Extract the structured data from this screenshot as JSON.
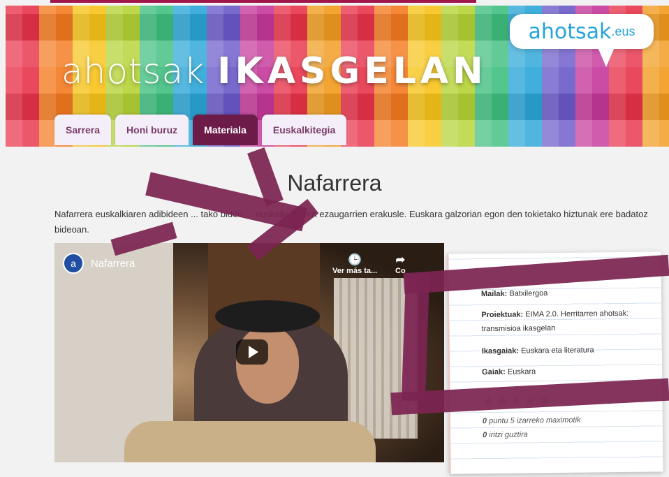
{
  "header": {
    "logo_part1": "ahotsak",
    "logo_part2": "IKASGELAN",
    "bubble_brand": "ahotsak",
    "bubble_tld": ".eus"
  },
  "tabs": [
    {
      "label": "Sarrera",
      "active": false
    },
    {
      "label": "Honi buruz",
      "active": false
    },
    {
      "label": "Materiala",
      "active": true
    },
    {
      "label": "Euskalkitegia",
      "active": false
    }
  ],
  "main": {
    "title": "Nafarrera",
    "intro": "Nafarrera euskalkiaren adibideen ... tako bideo ... euskalki horren ezaugarrien erakusle. Euskara galzorian egon den tokietako hiztunak ere badatoz bideoan."
  },
  "video": {
    "channel_initial": "a",
    "title": "Nafarrera",
    "watch_later": "Ver más ta...",
    "share": "Co"
  },
  "details": {
    "mailak_label": "Mailak:",
    "mailak_value": "Batxilergoa",
    "proiektuak_label": "Proiektuak:",
    "proiektuak_value": "EIMA 2.0. Herritarren ahotsak: transmisioa ikasgelan",
    "ikasgaiak_label": "Ikasgaiak:",
    "ikasgaiak_value": "Euskara eta literatura",
    "gaiak_label": "Gaiak:",
    "gaiak_value": "Euskara",
    "stars": "★★★★★",
    "rating_points_value": "0",
    "rating_points_text": "puntu 5 izarreko maximotik",
    "rating_count_value": "0",
    "rating_count_text": "iritzi guztira"
  }
}
